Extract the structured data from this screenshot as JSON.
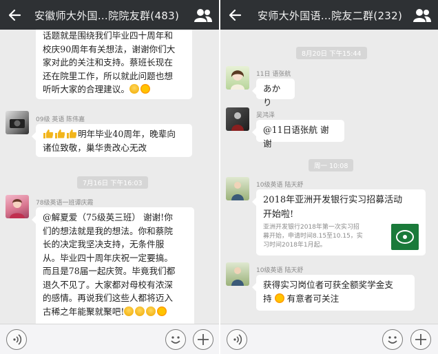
{
  "left": {
    "title": "安徽师大外国…院院友群(483)",
    "msg1": {
      "lines": [
        "话题就是围绕我们毕业四十周年和",
        "校庆90周年有关想法，谢谢你们大",
        "家对此的关注和支持。蔡班长现在",
        "还在院里工作，所以就此问题也想",
        "听听大家的合理建议。"
      ]
    },
    "msg2": {
      "sender": "09级 英语 陈伟嘉",
      "lines": [
        "明年毕业40周年，晚辈向",
        "诸位致敬，巢华贵改心无改"
      ]
    },
    "time1": "7月16日 下午16:03",
    "msg3": {
      "sender": "78级英语一班谭庆霞",
      "lines": [
        "@解夏爱（75级英三班） 谢谢!你",
        "们的想法就是我的想法。你和蔡院",
        "长的决定我坚决支持，无条件服",
        "从。毕业四十周年庆祝一定要搞。",
        "而且是78届一起庆贺。毕竟我们都",
        "退久不见了。大家都对母校有浓深",
        "的感情。再说我们这些人都将迈入",
        "古稀之年能聚就聚吧!"
      ]
    }
  },
  "right": {
    "title": "安师大外国语…院友二群(232)",
    "time1": "8月20日 下午15:44",
    "msg1": {
      "sender": "11日 语张航",
      "text": "あかり"
    },
    "msg2": {
      "sender": "吴鸿泽",
      "text": "@11日语张航 谢谢"
    },
    "time2": "周一 10:08",
    "msg3": {
      "sender": "10级英语 陆天舒",
      "title_lines": [
        "2018年亚洲开发银行实习招募活动",
        "开始啦!"
      ],
      "desc_lines": [
        "亚洲开发银行2018年第一次实习招",
        "募开始，申请时间8.15至10.15，实",
        "习时间2018年1月起。"
      ]
    },
    "msg4": {
      "sender": "10级英语 陆天舒",
      "lines": [
        "获得实习岗位者可获全额奖学金支",
        "持",
        "有意者可关注"
      ]
    }
  },
  "colors": {
    "topbar": "#2e3134",
    "chat_bg": "#ebebeb",
    "bubble": "#ffffff",
    "time_chip": "#d6d6d6"
  }
}
